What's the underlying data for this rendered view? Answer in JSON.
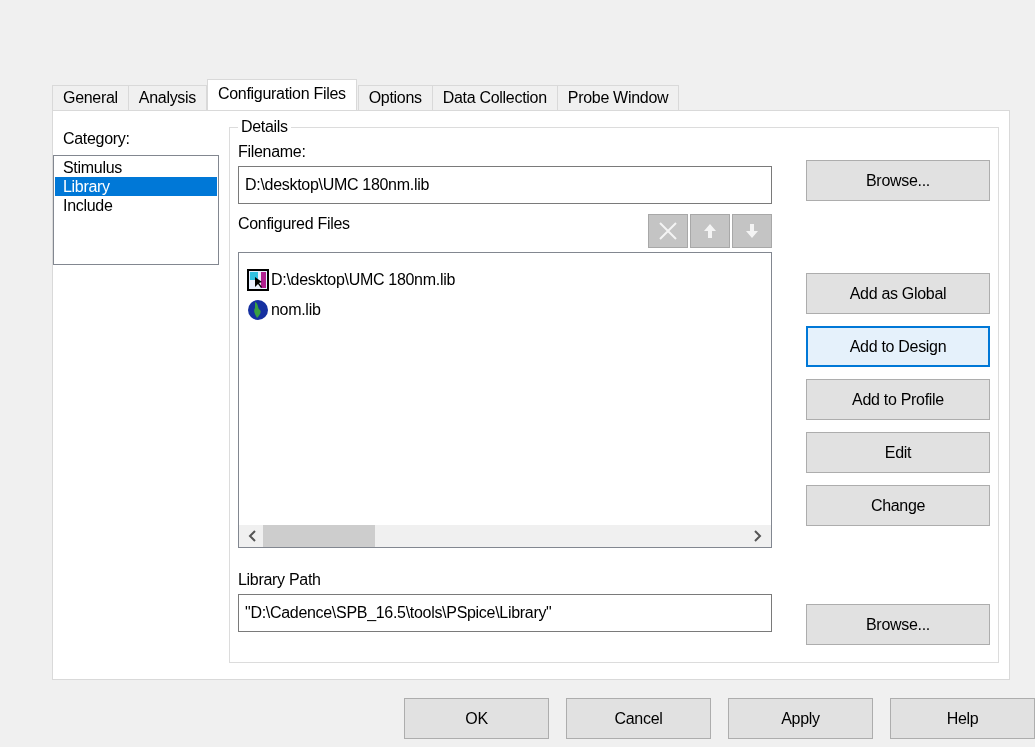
{
  "tabs": [
    {
      "label": "General",
      "selected": false
    },
    {
      "label": "Analysis",
      "selected": false
    },
    {
      "label": "Configuration Files",
      "selected": true
    },
    {
      "label": "Options",
      "selected": false
    },
    {
      "label": "Data Collection",
      "selected": false
    },
    {
      "label": "Probe Window",
      "selected": false
    }
  ],
  "category": {
    "label": "Category:",
    "items": [
      {
        "label": "Stimulus",
        "selected": false
      },
      {
        "label": "Library",
        "selected": true
      },
      {
        "label": "Include",
        "selected": false
      }
    ]
  },
  "details": {
    "title": "Details",
    "filename_label": "Filename:",
    "filename": "D:\\desktop\\UMC 180nm.lib",
    "browse": "Browse...",
    "configured_label": "Configured Files",
    "files": [
      {
        "kind": "design",
        "name": "D:\\desktop\\UMC 180nm.lib"
      },
      {
        "kind": "global",
        "name": "nom.lib"
      }
    ],
    "buttons": [
      {
        "label": "Add as Global",
        "focused": false
      },
      {
        "label": "Add to Design",
        "focused": true
      },
      {
        "label": "Add to Profile",
        "focused": false
      },
      {
        "label": "Edit",
        "focused": false
      },
      {
        "label": "Change",
        "focused": false
      }
    ],
    "library_path_label": "Library Path",
    "library_path": "\"D:\\Cadence\\SPB_16.5\\tools\\PSpice\\Library\"",
    "library_browse": "Browse..."
  },
  "dialog_buttons": [
    "OK",
    "Cancel",
    "Apply",
    "Help"
  ]
}
